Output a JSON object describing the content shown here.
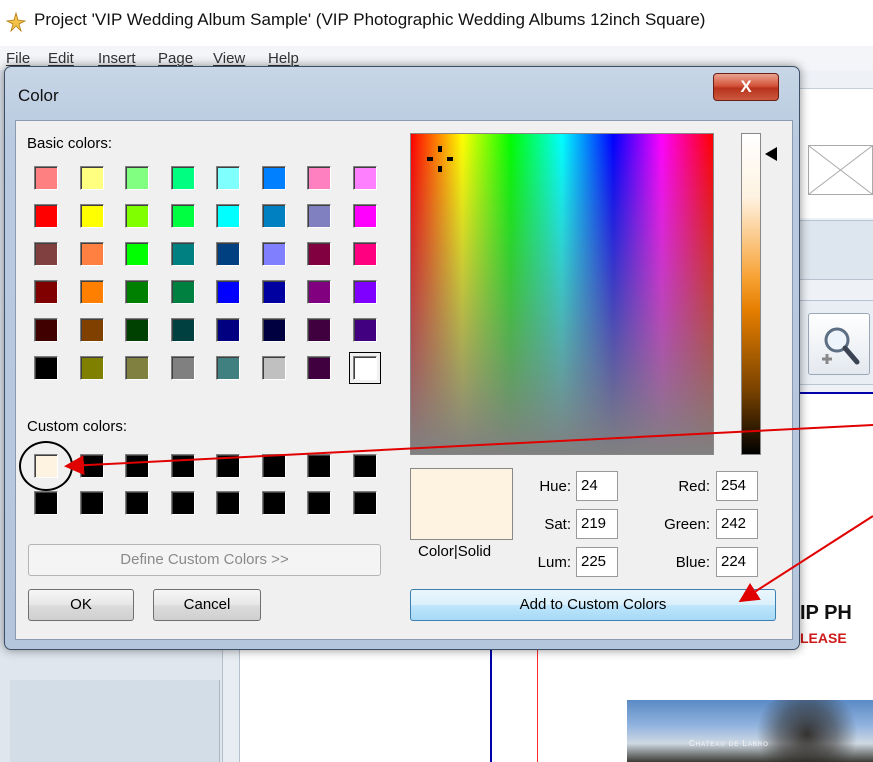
{
  "app": {
    "title": "Project 'VIP Wedding Album Sample' (VIP Photographic Wedding Albums 12inch Square)",
    "icon": "app-star-icon",
    "menu": [
      "File",
      "Edit",
      "Insert",
      "Page",
      "View",
      "Help"
    ]
  },
  "background": {
    "heading": "IP PH",
    "subheading": "LEASE",
    "photo_caption": "Chateau de Labro"
  },
  "dialog": {
    "title": "Color",
    "close_label": "X",
    "basic_colors_label": "Basic colors:",
    "custom_colors_label": "Custom colors:",
    "basic_colors": [
      "#ff8080",
      "#ffff80",
      "#80ff80",
      "#00ff80",
      "#80ffff",
      "#0080ff",
      "#ff80c0",
      "#ff80ff",
      "#ff0000",
      "#ffff00",
      "#80ff00",
      "#00ff40",
      "#00ffff",
      "#0080c0",
      "#8080c0",
      "#ff00ff",
      "#804040",
      "#ff8040",
      "#00ff00",
      "#008080",
      "#004080",
      "#8080ff",
      "#800040",
      "#ff0080",
      "#800000",
      "#ff8000",
      "#008000",
      "#008040",
      "#0000ff",
      "#0000a0",
      "#800080",
      "#8000ff",
      "#400000",
      "#804000",
      "#004000",
      "#004040",
      "#000080",
      "#000040",
      "#400040",
      "#400080",
      "#000000",
      "#808000",
      "#808040",
      "#808080",
      "#408080",
      "#c0c0c0",
      "#400040",
      "#ffffff"
    ],
    "custom_colors": [
      "#fef2e0",
      "#000000",
      "#000000",
      "#000000",
      "#000000",
      "#000000",
      "#000000",
      "#000000",
      "#000000",
      "#000000",
      "#000000",
      "#000000",
      "#000000",
      "#000000",
      "#000000",
      "#000000"
    ],
    "define_custom_label": "Define Custom Colors >>",
    "ok_label": "OK",
    "cancel_label": "Cancel",
    "add_custom_label": "Add to Custom Colors",
    "preview_label": "Color|Solid",
    "preview_color": "#fef2e0",
    "fields": {
      "hue_label": "Hue:",
      "hue": "24",
      "sat_label": "Sat:",
      "sat": "219",
      "lum_label": "Lum:",
      "lum": "225",
      "red_label": "Red:",
      "red": "254",
      "green_label": "Green:",
      "green": "242",
      "blue_label": "Blue:",
      "blue": "224"
    }
  },
  "colors": {
    "annotation_arrow": "#e00000",
    "dialog_frame": "#b9cbe0",
    "close_button": "#c8462b"
  }
}
